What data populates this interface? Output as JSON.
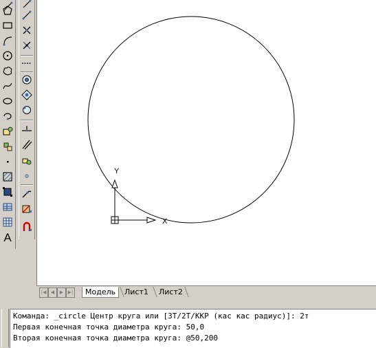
{
  "layout_tabs": {
    "model": "Модель",
    "sheet1": "Лист1",
    "sheet2": "Лист2"
  },
  "ucs": {
    "y_label": "Y",
    "x_label": "X"
  },
  "command_line": {
    "lines": [
      "Команда: _circle Центр круга или [3T/2T/ККР (кас кас радиус)]: 2т",
      "Первая конечная точка диаметра круга: 50,0",
      "Вторая конечная точка диаметра круга: @50,200"
    ]
  },
  "draw_toolbar": {
    "tools": [
      "line-icon",
      "polygon-icon",
      "rectangle-icon",
      "arc-icon",
      "circle-icon",
      "revision-cloud-icon",
      "spline-icon",
      "ellipse-icon",
      "ellipse-arc-icon",
      "insert-block-icon",
      "make-block-icon",
      "point-icon",
      "hatch-icon",
      "region-icon",
      "table-icon",
      "multiline-text-icon"
    ],
    "text_tool": "A"
  },
  "modify_toolbar": {
    "tools": [
      "erase-icon",
      "copy-icon",
      "mirror-icon",
      "offset-icon",
      "array-icon",
      "move-icon",
      "rotate-icon",
      "scale-icon",
      "stretch-icon",
      "trim-icon",
      "extend-icon",
      "break-icon",
      "join-icon",
      "chamfer-icon",
      "fillet-icon",
      "explode-icon"
    ]
  },
  "colors": {
    "drawing_bg": "#ffffff",
    "chrome": "#d4d0c8",
    "line": "#000000"
  }
}
